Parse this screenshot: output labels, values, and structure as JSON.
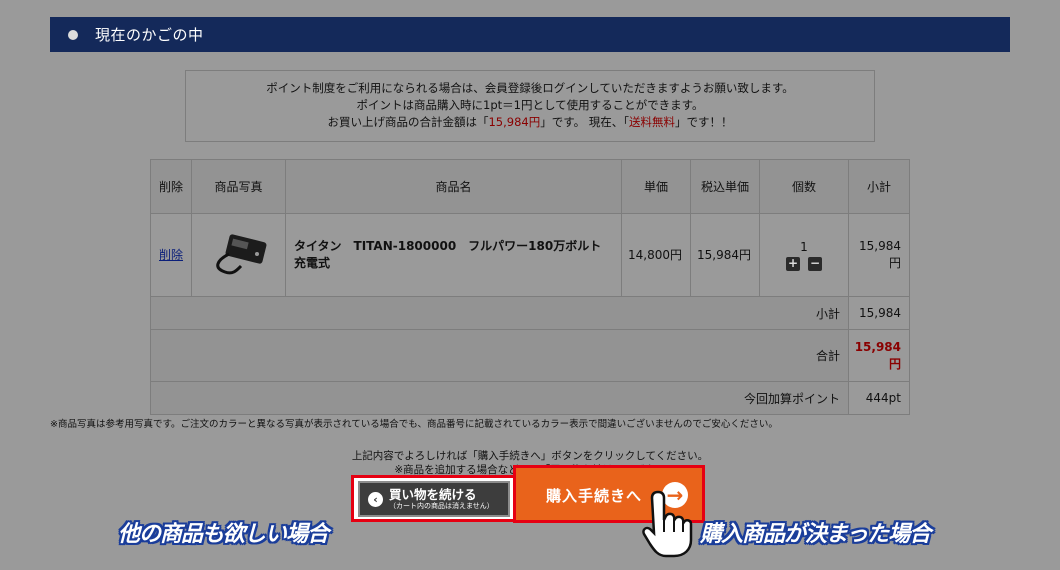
{
  "header": {
    "title": "現在のかごの中"
  },
  "notice": {
    "line1": "ポイント制度をご利用になられる場合は、会員登録後ログインしていただきますようお願い致します。",
    "line2": "ポイントは商品購入時に1pt＝1円として使用することができます。",
    "line3_prefix": "お買い上げ商品の合計金額は「",
    "line3_total": "15,984円",
    "line3_middle": "」です。 現在、「",
    "line3_shipping": "送料無料",
    "line3_suffix": "」です！！"
  },
  "table": {
    "headers": [
      "削除",
      "商品写真",
      "商品名",
      "単価",
      "税込単価",
      "個数",
      "小計"
    ],
    "item": {
      "delete_label": "削除",
      "name": "タイタン　TITAN-1800000　フルパワー180万ボルト　充電式",
      "unit_price": "14,800円",
      "unit_price_tax": "15,984円",
      "quantity": "1",
      "plus": "+",
      "minus": "−",
      "subtotal": "15,984円"
    },
    "subtotal_label": "小計",
    "subtotal_value": "15,984",
    "total_label": "合計",
    "total_value": "15,984円",
    "points_label": "今回加算ポイント",
    "points_value": "444pt"
  },
  "footnote": "※商品写真は参考用写真です。ご注文のカラーと異なる写真が表示されている場合でも、商品番号に記載されているカラー表示で間違いございませんのでご安心ください。",
  "guide": {
    "line1": "上記内容でよろしければ「購入手続きへ」ボタンをクリックしてください。",
    "line2": "※商品を追加する場合などには「買い物を続ける」ボタン"
  },
  "buttons": {
    "continue_label": "買い物を続ける",
    "continue_sub": "（カート内の商品は消えません）",
    "checkout_label": "購入手続きへ"
  },
  "callouts": {
    "left": "他の商品も欲しい場合",
    "right": "購入商品が決まった場合"
  },
  "colors": {
    "header": "#14295a",
    "checkout": "#e9631b",
    "highlight": "#e60012",
    "price_red": "#8a0000"
  }
}
